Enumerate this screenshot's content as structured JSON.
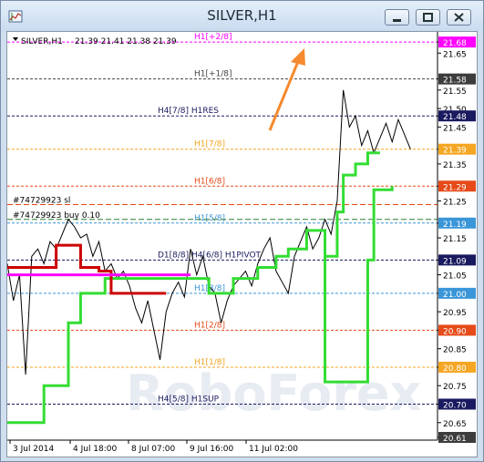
{
  "window": {
    "title": "SILVER,H1"
  },
  "header": {
    "symbol": "SILVER,H1",
    "ohlc": "21.39 21.41 21.38 21.39"
  },
  "watermark": "RoboForex",
  "price_labels": [
    {
      "text": "21.68",
      "value": 21.68,
      "bg": "#ff00ff",
      "fg": "#ffffff"
    },
    {
      "text": "21.65",
      "value": 21.65,
      "bg": null,
      "fg": "#000000"
    },
    {
      "text": "21.58",
      "value": 21.58,
      "bg": "#3c3c3c",
      "fg": "#ffffff"
    },
    {
      "text": "21.55",
      "value": 21.55,
      "bg": null,
      "fg": "#000000"
    },
    {
      "text": "21.50",
      "value": 21.5,
      "bg": null,
      "fg": "#000000"
    },
    {
      "text": "21.48",
      "value": 21.48,
      "bg": "#1a1a60",
      "fg": "#ffffff"
    },
    {
      "text": "21.45",
      "value": 21.45,
      "bg": null,
      "fg": "#000000"
    },
    {
      "text": "21.39",
      "value": 21.39,
      "bg": "#f5a623",
      "fg": "#ffffff"
    },
    {
      "text": "21.35",
      "value": 21.35,
      "bg": null,
      "fg": "#000000"
    },
    {
      "text": "21.29",
      "value": 21.29,
      "bg": "#e64a19",
      "fg": "#ffffff"
    },
    {
      "text": "21.25",
      "value": 21.25,
      "bg": null,
      "fg": "#000000"
    },
    {
      "text": "21.19",
      "value": 21.19,
      "bg": "#3a96d8",
      "fg": "#ffffff"
    },
    {
      "text": "21.15",
      "value": 21.15,
      "bg": null,
      "fg": "#000000"
    },
    {
      "text": "21.09",
      "value": 21.09,
      "bg": "#1a1a60",
      "fg": "#ffffff"
    },
    {
      "text": "21.05",
      "value": 21.05,
      "bg": null,
      "fg": "#000000"
    },
    {
      "text": "21.00",
      "value": 21.0,
      "bg": "#3a96d8",
      "fg": "#ffffff"
    },
    {
      "text": "20.95",
      "value": 20.95,
      "bg": null,
      "fg": "#000000"
    },
    {
      "text": "20.90",
      "value": 20.9,
      "bg": "#e64a19",
      "fg": "#ffffff"
    },
    {
      "text": "20.85",
      "value": 20.85,
      "bg": null,
      "fg": "#000000"
    },
    {
      "text": "20.80",
      "value": 20.8,
      "bg": "#f5a623",
      "fg": "#ffffff"
    },
    {
      "text": "20.75",
      "value": 20.75,
      "bg": null,
      "fg": "#000000"
    },
    {
      "text": "20.70",
      "value": 20.7,
      "bg": "#1a1a60",
      "fg": "#ffffff"
    },
    {
      "text": "20.65",
      "value": 20.65,
      "bg": null,
      "fg": "#000000"
    },
    {
      "text": "20.61",
      "value": 20.61,
      "bg": "#3c3c3c",
      "fg": "#ffffff"
    }
  ],
  "levels": [
    {
      "price": 21.68,
      "label": "H1[+2/8]",
      "color": "#ff00ff"
    },
    {
      "price": 21.58,
      "label": "H1[+1/8]",
      "color": "#444444"
    },
    {
      "price": 21.48,
      "label": "H4[7/8] H1RES",
      "color": "#1a1a60"
    },
    {
      "price": 21.39,
      "label": "H1[7/8]",
      "color": "#f5a623"
    },
    {
      "price": 21.29,
      "label": "H1[6/8]",
      "color": "#e64a19"
    },
    {
      "price": 21.19,
      "label": "H1[5/8]",
      "color": "#3a96d8"
    },
    {
      "price": 21.09,
      "label": "D1[8/8] H4[6/8] H1PIVOT",
      "color": "#1a1a60"
    },
    {
      "price": 21.0,
      "label": "H1[3/8]",
      "color": "#3a96d8"
    },
    {
      "price": 20.9,
      "label": "H1[2/8]",
      "color": "#e64a19"
    },
    {
      "price": 20.8,
      "label": "H1[1/8]",
      "color": "#f5a623"
    },
    {
      "price": 20.7,
      "label": "H4[5/8] H1SUP",
      "color": "#1a1a60"
    }
  ],
  "order_lines": [
    {
      "label": "#74729923 sl",
      "price": 21.24,
      "color": "#e64a19"
    },
    {
      "label": "#74729923 buy 0.10",
      "price": 21.2,
      "color": "#2e7d32"
    }
  ],
  "time_labels": [
    "3 Jul 2014",
    "4 Jul 18:00",
    "8 Jul 07:00",
    "9 Jul 16:00",
    "11 Jul 02:00"
  ],
  "chart_data": {
    "type": "line",
    "title": "SILVER,H1",
    "ylim": [
      20.61,
      21.7
    ],
    "x_range": [
      0,
      100
    ],
    "series": [
      {
        "name": "price",
        "color": "#000000",
        "points": [
          [
            0,
            21.08
          ],
          [
            1,
            20.98
          ],
          [
            2,
            21.05
          ],
          [
            3,
            20.78
          ],
          [
            4,
            21.1
          ],
          [
            5,
            21.12
          ],
          [
            6,
            21.08
          ],
          [
            7,
            21.14
          ],
          [
            8,
            21.12
          ],
          [
            9,
            21.16
          ],
          [
            10,
            21.2
          ],
          [
            11,
            21.18
          ],
          [
            12,
            21.15
          ],
          [
            13,
            21.16
          ],
          [
            14,
            21.1
          ],
          [
            15,
            21.14
          ],
          [
            16,
            21.06
          ],
          [
            17,
            21.08
          ],
          [
            18,
            21.04
          ],
          [
            19,
            21.06
          ],
          [
            20,
            21.02
          ],
          [
            21,
            20.96
          ],
          [
            22,
            20.92
          ],
          [
            23,
            20.98
          ],
          [
            24,
            20.9
          ],
          [
            25,
            20.82
          ],
          [
            26,
            20.95
          ],
          [
            27,
            21.0
          ],
          [
            28,
            21.03
          ],
          [
            29,
            20.99
          ],
          [
            30,
            21.12
          ],
          [
            31,
            21.05
          ],
          [
            32,
            21.1
          ],
          [
            33,
            21.02
          ],
          [
            34,
            21.0
          ],
          [
            35,
            20.92
          ],
          [
            36,
            20.98
          ],
          [
            37,
            21.02
          ],
          [
            38,
            21.04
          ],
          [
            39,
            21.06
          ],
          [
            40,
            21.02
          ],
          [
            41,
            21.08
          ],
          [
            42,
            21.12
          ],
          [
            43,
            21.15
          ],
          [
            44,
            21.06
          ],
          [
            45,
            21.03
          ],
          [
            46,
            21.0
          ],
          [
            47,
            21.1
          ],
          [
            48,
            21.14
          ],
          [
            49,
            21.18
          ],
          [
            50,
            21.12
          ],
          [
            51,
            21.15
          ],
          [
            52,
            21.2
          ],
          [
            53,
            21.16
          ],
          [
            54,
            21.25
          ],
          [
            55,
            21.55
          ],
          [
            56,
            21.45
          ],
          [
            57,
            21.48
          ],
          [
            58,
            21.4
          ],
          [
            59,
            21.44
          ],
          [
            60,
            21.38
          ],
          [
            61,
            21.42
          ],
          [
            62,
            21.46
          ],
          [
            63,
            21.41
          ],
          [
            64,
            21.47
          ],
          [
            65,
            21.43
          ],
          [
            66,
            21.39
          ]
        ]
      },
      {
        "name": "trail_green",
        "color": "#33dd33",
        "points": [
          [
            0,
            20.65
          ],
          [
            6,
            20.65
          ],
          [
            6,
            20.75
          ],
          [
            10,
            20.75
          ],
          [
            10,
            20.92
          ],
          [
            12,
            20.92
          ],
          [
            12,
            21.0
          ],
          [
            16,
            21.0
          ],
          [
            16,
            21.04
          ],
          [
            23,
            21.04
          ],
          [
            23,
            21.04
          ],
          [
            33,
            21.04
          ],
          [
            33,
            21.0
          ],
          [
            37,
            21.0
          ],
          [
            37,
            21.04
          ],
          [
            41,
            21.04
          ],
          [
            41,
            21.07
          ],
          [
            44,
            21.07
          ],
          [
            44,
            21.1
          ],
          [
            46,
            21.1
          ],
          [
            46,
            21.12
          ],
          [
            49,
            21.12
          ],
          [
            49,
            21.17
          ],
          [
            52,
            21.17
          ],
          [
            52,
            20.76
          ],
          [
            55,
            20.76
          ],
          [
            55,
            20.76
          ],
          [
            59,
            20.76
          ],
          [
            59,
            21.09
          ],
          [
            60,
            21.09
          ],
          [
            60,
            21.28
          ],
          [
            63,
            21.28
          ],
          [
            63,
            21.29
          ]
        ]
      },
      {
        "name": "trail_green_upper",
        "color": "#33dd33",
        "points": [
          [
            52,
            21.1
          ],
          [
            54,
            21.1
          ],
          [
            54,
            21.22
          ],
          [
            55,
            21.22
          ],
          [
            55,
            21.32
          ],
          [
            57,
            21.32
          ],
          [
            57,
            21.35
          ],
          [
            59,
            21.35
          ],
          [
            59,
            21.38
          ],
          [
            61,
            21.38
          ]
        ]
      },
      {
        "name": "trail_red",
        "color": "#cc0000",
        "points": [
          [
            0,
            21.07
          ],
          [
            5,
            21.07
          ],
          [
            5,
            21.07
          ],
          [
            8,
            21.07
          ],
          [
            8,
            21.13
          ],
          [
            12,
            21.13
          ],
          [
            12,
            21.07
          ],
          [
            15,
            21.07
          ],
          [
            15,
            21.06
          ],
          [
            17,
            21.06
          ],
          [
            17,
            21.0
          ],
          [
            23,
            21.0
          ],
          [
            23,
            21.0
          ],
          [
            26,
            21.0
          ]
        ]
      },
      {
        "name": "trail_magenta",
        "color": "#ff00ff",
        "points": [
          [
            0,
            21.05
          ],
          [
            3,
            21.05
          ],
          [
            3,
            21.05
          ],
          [
            13,
            21.05
          ],
          [
            13,
            21.05
          ],
          [
            30,
            21.05
          ]
        ]
      }
    ]
  }
}
